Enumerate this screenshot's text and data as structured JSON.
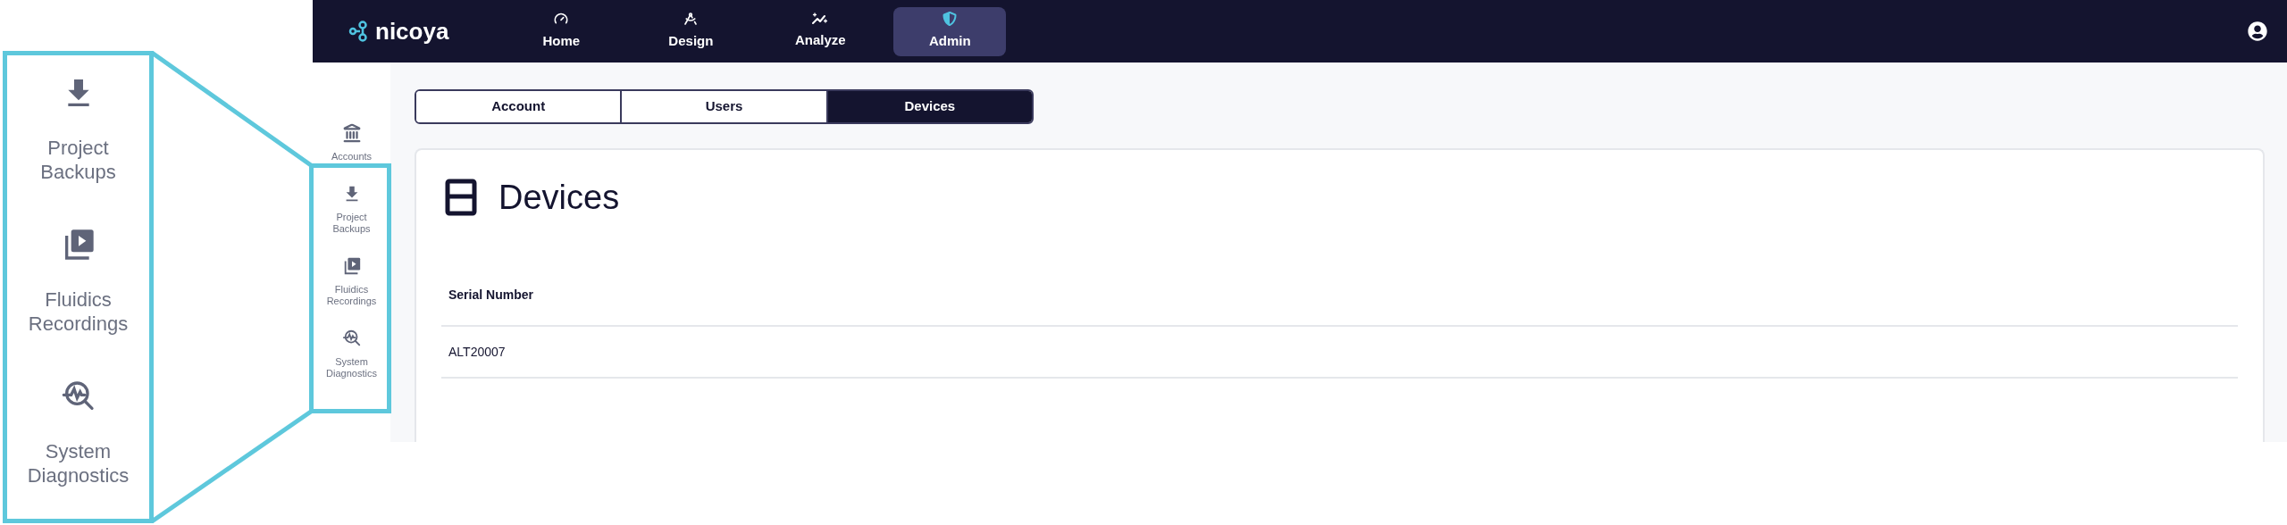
{
  "callout": {
    "items": [
      {
        "kind": "backups",
        "label": "Project Backups"
      },
      {
        "kind": "recordings",
        "label": "Fluidics Recordings"
      },
      {
        "kind": "diagnostics",
        "label": "System Diagnostics"
      }
    ]
  },
  "navbar": {
    "logo": "nicoya",
    "items": [
      {
        "kind": "home",
        "label": "Home",
        "selected": false
      },
      {
        "kind": "design",
        "label": "Design",
        "selected": false
      },
      {
        "kind": "analyze",
        "label": "Analyze",
        "selected": false
      },
      {
        "kind": "admin",
        "label": "Admin",
        "selected": true
      }
    ]
  },
  "sidebar": {
    "items": [
      {
        "kind": "accounts",
        "label": "Accounts",
        "selected": false
      },
      {
        "kind": "backups",
        "label": "Project Backups",
        "selected": false
      },
      {
        "kind": "recordings",
        "label": "Fluidics Recordings",
        "selected": false
      },
      {
        "kind": "diagnostics",
        "label": "System Diagnostics",
        "selected": false
      }
    ]
  },
  "tabs": [
    {
      "label": "Account",
      "selected": false
    },
    {
      "label": "Users",
      "selected": false
    },
    {
      "label": "Devices",
      "selected": true
    }
  ],
  "card": {
    "title": "Devices",
    "table": {
      "columns": [
        "Serial Number"
      ],
      "rows": [
        [
          "ALT20007"
        ]
      ]
    }
  }
}
